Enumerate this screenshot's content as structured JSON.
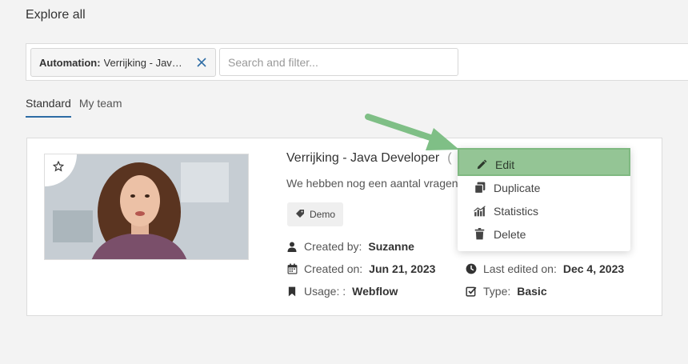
{
  "page": {
    "title": "Explore all"
  },
  "filter": {
    "chip_key": "Automation:",
    "chip_value": "Verrijking - Java Developer",
    "search_placeholder": "Search and filter..."
  },
  "tabs": [
    {
      "label": "Standard",
      "active": true
    },
    {
      "label": "My team",
      "active": false
    }
  ],
  "card": {
    "title": "Verrijking - Java Developer",
    "title_suffix": "(",
    "description": "We hebben nog een aantal vragen",
    "tag": "Demo",
    "meta": {
      "created_by_label": "Created by:",
      "created_by_value": "Suzanne",
      "created_on_label": "Created on:",
      "created_on_value": "Jun 21, 2023",
      "usage_label": "Usage: :",
      "usage_value": "Webflow",
      "last_edited_label": "Last edited on:",
      "last_edited_value": "Dec 4, 2023",
      "type_label": "Type:",
      "type_value": "Basic"
    }
  },
  "menu": {
    "items": [
      {
        "label": "Edit",
        "icon": "pencil-icon"
      },
      {
        "label": "Duplicate",
        "icon": "copy-icon"
      },
      {
        "label": "Statistics",
        "icon": "bar-chart-icon"
      },
      {
        "label": "Delete",
        "icon": "trash-icon"
      }
    ]
  },
  "colors": {
    "accent_tab": "#2d6ca5",
    "highlight": "#94c595",
    "arrow": "#7fbf86"
  }
}
